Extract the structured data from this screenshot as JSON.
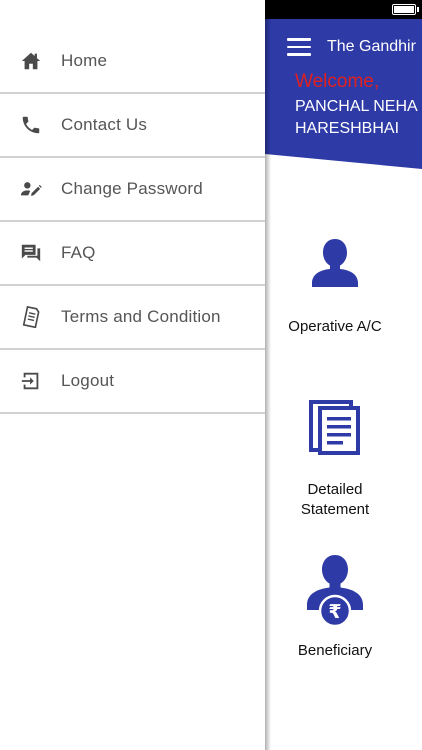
{
  "drawer": {
    "items": [
      {
        "label": "Home",
        "icon": "home-icon"
      },
      {
        "label": "Contact Us",
        "icon": "phone-icon"
      },
      {
        "label": "Change Password",
        "icon": "edit-user-icon"
      },
      {
        "label": "FAQ",
        "icon": "chat-icon"
      },
      {
        "label": "Terms and Condition",
        "icon": "document-icon"
      },
      {
        "label": "Logout",
        "icon": "logout-icon"
      }
    ]
  },
  "header": {
    "title": "The Gandhir",
    "welcome": "Welcome,",
    "user_line1": "PANCHAL NEHA",
    "user_line2": "HARESHBHAI"
  },
  "tiles": [
    {
      "label": "Operative A/C",
      "icon": "user-icon"
    },
    {
      "label_line1": "Detailed",
      "label_line2": "Statement",
      "icon": "statement-icon"
    },
    {
      "label": "Beneficiary",
      "icon": "beneficiary-icon"
    }
  ],
  "colors": {
    "primary": "#2e3aa6",
    "welcome_red": "#e02020",
    "drawer_text": "#555555",
    "icon_gray": "#4a4a4a",
    "divider": "#d2d2d2"
  }
}
